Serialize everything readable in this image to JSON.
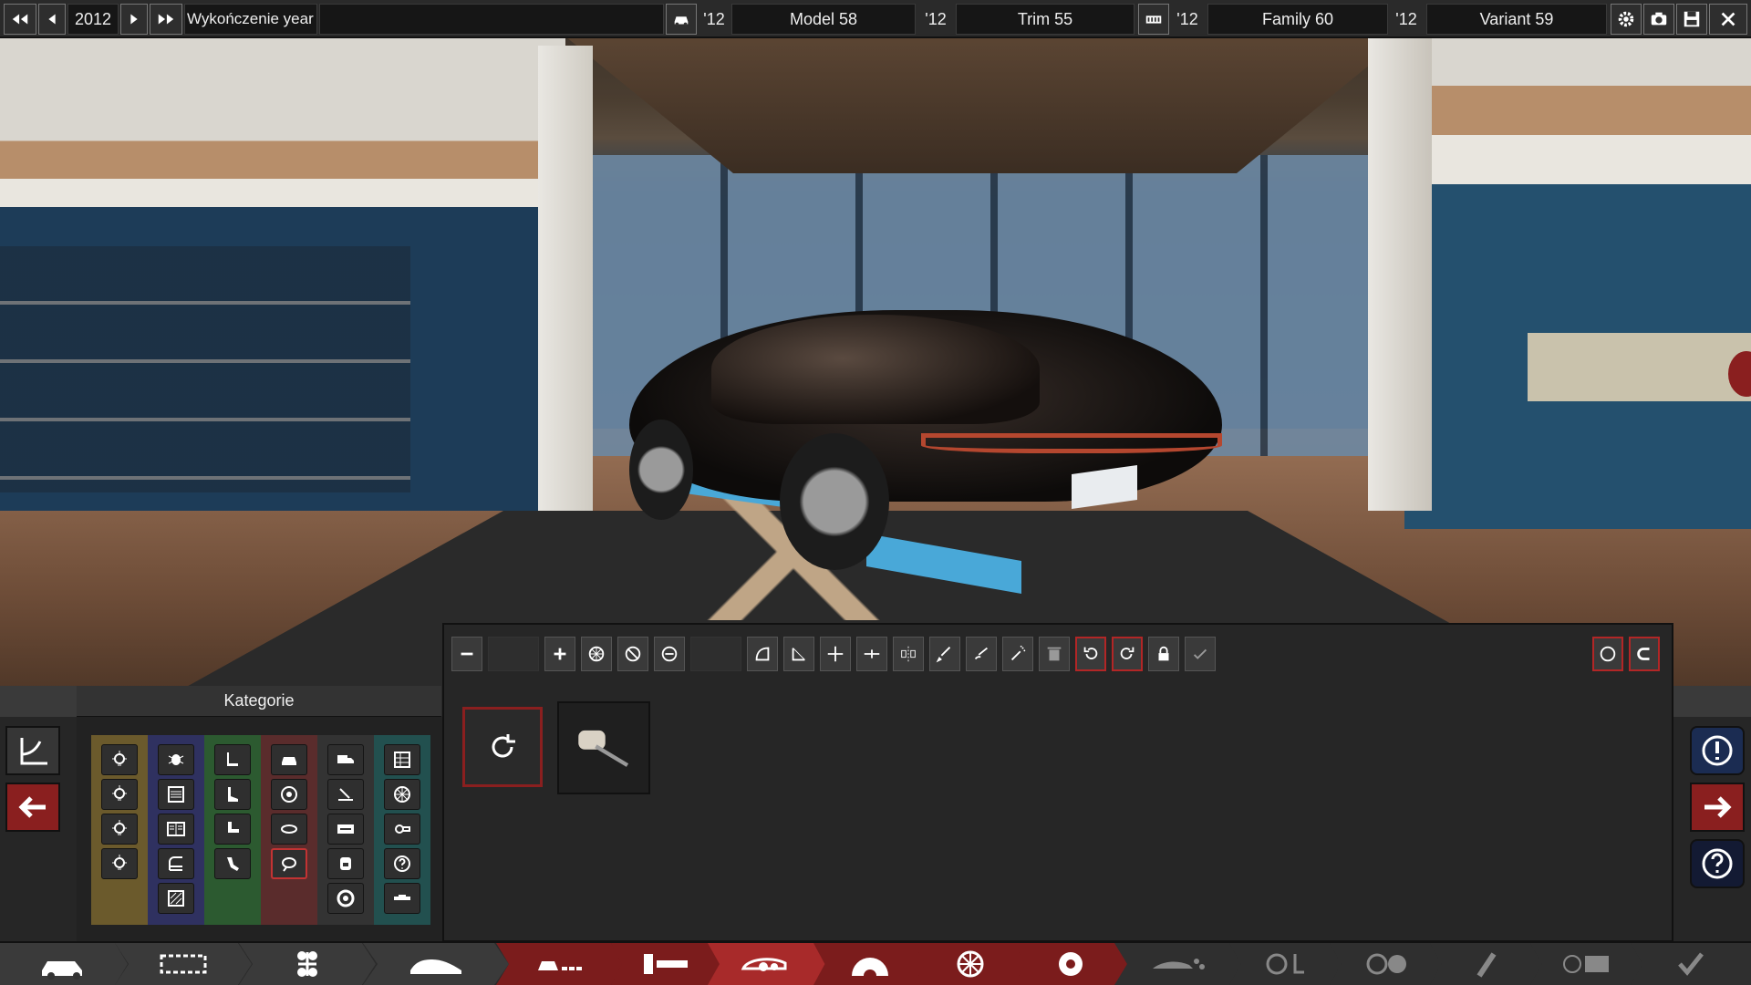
{
  "topbar": {
    "year": "2012",
    "title": "Wykończenie year",
    "model_year": "'12",
    "model": "Model 58",
    "trim_year": "'12",
    "trim": "Trim 55",
    "family_year": "'12",
    "family": "Family 60",
    "variant_year": "'12",
    "variant": "Variant 59"
  },
  "categories": {
    "header": "Kategorie"
  },
  "colors": {
    "accent_red": "#b22626",
    "active_red": "#a82a2a",
    "panel": "#262626"
  },
  "category_columns": [
    {
      "tint": "#6b5a2c",
      "icons": [
        "light-icon",
        "light-icon",
        "light-icon",
        "light-icon"
      ]
    },
    {
      "tint": "#2f3160",
      "icons": [
        "bug-icon",
        "vent-icon",
        "panel-icon",
        "trim-icon",
        "grille-icon"
      ]
    },
    {
      "tint": "#2c5a30",
      "icons": [
        "seat-icon",
        "seat-icon",
        "seat-icon",
        "seat-icon"
      ]
    },
    {
      "tint": "#5a2c2c",
      "icons": [
        "car-front-icon",
        "wheel-icon",
        "handle-icon",
        "mirror-icon"
      ]
    },
    {
      "tint": "#333333",
      "icons": [
        "truck-icon",
        "antenna-icon",
        "plate-icon",
        "lamp-icon",
        "target-icon"
      ]
    },
    {
      "tint": "#22504f",
      "icons": [
        "grid-icon",
        "rim-icon",
        "exhaust-icon",
        "help-icon",
        "bar-icon"
      ]
    }
  ],
  "bottom_nav": [
    "car-icon",
    "engine-block-icon",
    "chassis-icon",
    "body-icon",
    "fixtures-icon",
    "trim-bar-icon",
    "headlight-icon",
    "gear-half-icon",
    "wheel-spoke-icon",
    "brake-icon",
    "car-silhouette-icon",
    "steering-icon",
    "steering-wheel-icon",
    "spray-icon",
    "flag-icon",
    "check-icon"
  ]
}
